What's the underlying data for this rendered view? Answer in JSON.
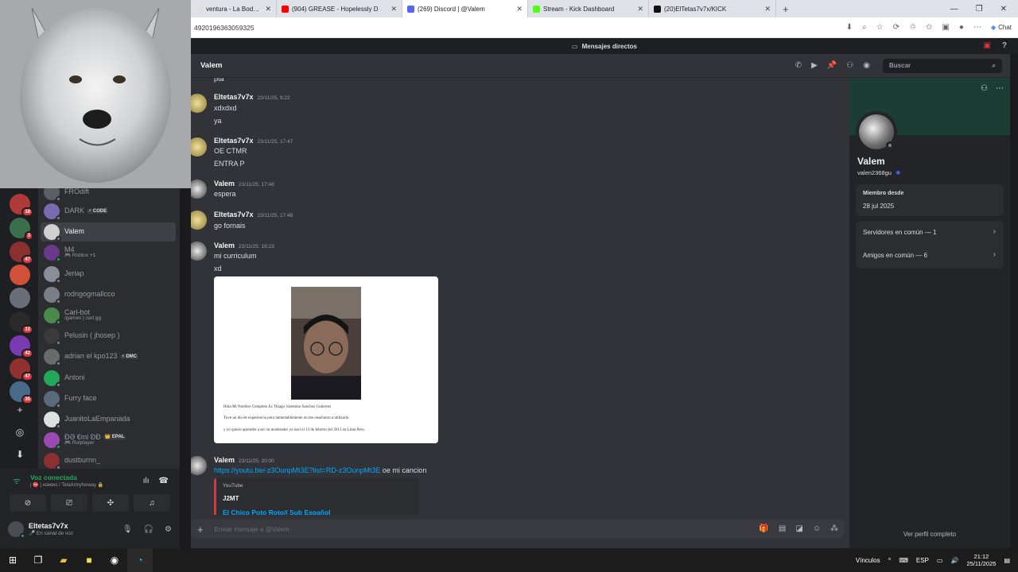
{
  "browser": {
    "tabs": [
      {
        "title": "ventura - La Boda - YouTu",
        "icon_color": "#e0e0e0",
        "active": false
      },
      {
        "title": "(904) GREASE - Hopelessly D",
        "icon_color": "#ff0000",
        "active": false
      },
      {
        "title": "(269) Discord | @Valem",
        "icon_color": "#5865f2",
        "active": true
      },
      {
        "title": "Stream - Kick Dashboard",
        "icon_color": "#53fc18",
        "active": false
      },
      {
        "title": "(20)ElTetas7v7x/KICK",
        "icon_color": "#111111",
        "active": false
      }
    ],
    "new_tab": "+",
    "url": "4920196363059325",
    "chat_label": "Chat"
  },
  "discord": {
    "window_title": "Mensajes directos",
    "servers": [
      {
        "color": "#b03a3a",
        "badge": "18"
      },
      {
        "color": "#3a6e4a",
        "badge": "3"
      },
      {
        "color": "#8a3030",
        "badge": "47"
      },
      {
        "color": "#d0503a",
        "badge": ""
      },
      {
        "color": "#6a6e76",
        "badge": ""
      },
      {
        "color": "#2a2a2a",
        "badge": "12"
      },
      {
        "color": "#7a3ab0",
        "badge": "42"
      },
      {
        "color": "#903030",
        "badge": "47"
      },
      {
        "color": "#4a6a8a",
        "badge": "35"
      }
    ],
    "dms": [
      {
        "name": "FROdift",
        "sub": "",
        "tag": "",
        "color": "#5a5e66",
        "status": "#80848e"
      },
      {
        "name": "DARK",
        "sub": "",
        "tag": "⚡ CODE",
        "color": "#7a6ab0",
        "status": "#80848e"
      },
      {
        "name": "Valem",
        "sub": "",
        "tag": "",
        "color": "#d0d0d0",
        "status": "#80848e",
        "selected": true
      },
      {
        "name": "M4",
        "sub": "🎮 Roblox +1",
        "tag": "",
        "color": "#6a3a8a",
        "status": "#23a55a"
      },
      {
        "name": "Jeriap",
        "sub": "",
        "tag": "",
        "color": "#8a8e96",
        "status": "#80848e"
      },
      {
        "name": "rodrigogmallcco",
        "sub": "",
        "tag": "",
        "color": "#7a7e86",
        "status": "#80848e"
      },
      {
        "name": "Carl-bot",
        "sub": "/games | carl.gg",
        "tag": "",
        "color": "#4a8a4a",
        "status": "#23a55a"
      },
      {
        "name": "Pelusin ( jhosep )",
        "sub": "",
        "tag": "",
        "color": "#3a3a3a",
        "status": "#80848e"
      },
      {
        "name": "adrian el kpo123",
        "sub": "",
        "tag": "⚡ DMC",
        "color": "#6a6a6a",
        "status": "#80848e"
      },
      {
        "name": "Antoni",
        "sub": "",
        "tag": "",
        "color": "#23a55a",
        "status": "#80848e"
      },
      {
        "name": "Furry face",
        "sub": "",
        "tag": "",
        "color": "#5a6a7a",
        "status": "#80848e"
      },
      {
        "name": "JuanitoLaEmpanada",
        "sub": "",
        "tag": "",
        "color": "#e0e0e0",
        "status": "#80848e"
      },
      {
        "name": "ÐƏ €mi ÐÐ",
        "sub": "🎮 Rolplayer",
        "tag": "👑 EPAL",
        "color": "#9a4ab0",
        "status": "#23a55a"
      },
      {
        "name": "dustburnn_",
        "sub": "",
        "tag": "",
        "color": "#8a3030",
        "status": "#80848e"
      }
    ],
    "voice": {
      "status": "Voz conectada",
      "channel": "| ⛔ | ᴀᴅᴍɪɴs / TetaArmyNoway 🔒"
    },
    "user": {
      "name": "Eltetas7v7x",
      "sub": "🎤 En canal de voz"
    },
    "chat": {
      "recipient": "Valem",
      "search_placeholder": "Buscar",
      "cut_line": "pta",
      "messages": [
        {
          "author": "Eltetas7v7x",
          "time": "23/11/25, 9:22",
          "lines": [
            "xdxdxd",
            "ya"
          ]
        },
        {
          "author": "Eltetas7v7x",
          "time": "23/11/25, 17:47",
          "lines": [
            "OE CTMR",
            "ENTRA P"
          ]
        },
        {
          "author": "Valem",
          "time": "23/11/25, 17:48",
          "lines": [
            "espera"
          ]
        },
        {
          "author": "Eltetas7v7x",
          "time": "23/11/25, 17:48",
          "lines": [
            "go fornais"
          ]
        },
        {
          "author": "Valem",
          "time": "23/11/25, 19:23",
          "lines": [
            "mi curriculum",
            "xd"
          ]
        },
        {
          "author": "Valem",
          "time": "23/11/25, 20:00",
          "lines": []
        }
      ],
      "attachment_text": [
        "Hola Mi Nombre Completo Es Thiago Valentino Sanchez Gutierrez",
        "Tuve un dia de experiencia pero lamentablemente no me enseñaron a utilizarlo",
        "y yo quiero aprender a ser un moderador yo naci el 13 de febrero del 2013 en Lima Peru."
      ],
      "link_url": "https://youtu.be/-z3OunpMt3E?list=RD-z3OunpMt3E",
      "link_suffix": " oe mi cancion",
      "embed": {
        "provider": "YouTube",
        "author": "J2MT",
        "title": "El Chico Poto Roto// Sub Español"
      },
      "input_placeholder": "Enviar mensaje a @Valem"
    },
    "profile": {
      "display_name": "Valem",
      "handle": "valen2368gu",
      "member_since_label": "Miembro desde",
      "member_since": "28 jul 2025",
      "servers_common": "Servidores en común — 1",
      "friends_common": "Amigos en común — 6",
      "full_profile": "Ver perfil completo"
    }
  },
  "taskbar": {
    "vinculos": "Vínculos",
    "lang": "ESP",
    "time": "21:12",
    "date": "25/11/2025"
  }
}
